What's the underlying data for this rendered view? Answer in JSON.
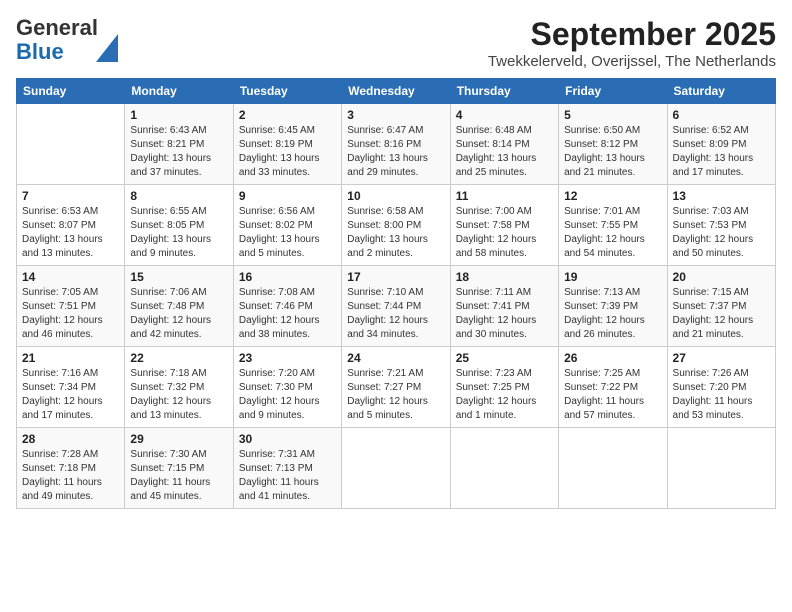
{
  "header": {
    "logo_line1": "General",
    "logo_line2": "Blue",
    "title": "September 2025",
    "subtitle": "Twekkelerveld, Overijssel, The Netherlands"
  },
  "columns": [
    "Sunday",
    "Monday",
    "Tuesday",
    "Wednesday",
    "Thursday",
    "Friday",
    "Saturday"
  ],
  "weeks": [
    [
      {
        "day": "",
        "info": ""
      },
      {
        "day": "1",
        "info": "Sunrise: 6:43 AM\nSunset: 8:21 PM\nDaylight: 13 hours\nand 37 minutes."
      },
      {
        "day": "2",
        "info": "Sunrise: 6:45 AM\nSunset: 8:19 PM\nDaylight: 13 hours\nand 33 minutes."
      },
      {
        "day": "3",
        "info": "Sunrise: 6:47 AM\nSunset: 8:16 PM\nDaylight: 13 hours\nand 29 minutes."
      },
      {
        "day": "4",
        "info": "Sunrise: 6:48 AM\nSunset: 8:14 PM\nDaylight: 13 hours\nand 25 minutes."
      },
      {
        "day": "5",
        "info": "Sunrise: 6:50 AM\nSunset: 8:12 PM\nDaylight: 13 hours\nand 21 minutes."
      },
      {
        "day": "6",
        "info": "Sunrise: 6:52 AM\nSunset: 8:09 PM\nDaylight: 13 hours\nand 17 minutes."
      }
    ],
    [
      {
        "day": "7",
        "info": "Sunrise: 6:53 AM\nSunset: 8:07 PM\nDaylight: 13 hours\nand 13 minutes."
      },
      {
        "day": "8",
        "info": "Sunrise: 6:55 AM\nSunset: 8:05 PM\nDaylight: 13 hours\nand 9 minutes."
      },
      {
        "day": "9",
        "info": "Sunrise: 6:56 AM\nSunset: 8:02 PM\nDaylight: 13 hours\nand 5 minutes."
      },
      {
        "day": "10",
        "info": "Sunrise: 6:58 AM\nSunset: 8:00 PM\nDaylight: 13 hours\nand 2 minutes."
      },
      {
        "day": "11",
        "info": "Sunrise: 7:00 AM\nSunset: 7:58 PM\nDaylight: 12 hours\nand 58 minutes."
      },
      {
        "day": "12",
        "info": "Sunrise: 7:01 AM\nSunset: 7:55 PM\nDaylight: 12 hours\nand 54 minutes."
      },
      {
        "day": "13",
        "info": "Sunrise: 7:03 AM\nSunset: 7:53 PM\nDaylight: 12 hours\nand 50 minutes."
      }
    ],
    [
      {
        "day": "14",
        "info": "Sunrise: 7:05 AM\nSunset: 7:51 PM\nDaylight: 12 hours\nand 46 minutes."
      },
      {
        "day": "15",
        "info": "Sunrise: 7:06 AM\nSunset: 7:48 PM\nDaylight: 12 hours\nand 42 minutes."
      },
      {
        "day": "16",
        "info": "Sunrise: 7:08 AM\nSunset: 7:46 PM\nDaylight: 12 hours\nand 38 minutes."
      },
      {
        "day": "17",
        "info": "Sunrise: 7:10 AM\nSunset: 7:44 PM\nDaylight: 12 hours\nand 34 minutes."
      },
      {
        "day": "18",
        "info": "Sunrise: 7:11 AM\nSunset: 7:41 PM\nDaylight: 12 hours\nand 30 minutes."
      },
      {
        "day": "19",
        "info": "Sunrise: 7:13 AM\nSunset: 7:39 PM\nDaylight: 12 hours\nand 26 minutes."
      },
      {
        "day": "20",
        "info": "Sunrise: 7:15 AM\nSunset: 7:37 PM\nDaylight: 12 hours\nand 21 minutes."
      }
    ],
    [
      {
        "day": "21",
        "info": "Sunrise: 7:16 AM\nSunset: 7:34 PM\nDaylight: 12 hours\nand 17 minutes."
      },
      {
        "day": "22",
        "info": "Sunrise: 7:18 AM\nSunset: 7:32 PM\nDaylight: 12 hours\nand 13 minutes."
      },
      {
        "day": "23",
        "info": "Sunrise: 7:20 AM\nSunset: 7:30 PM\nDaylight: 12 hours\nand 9 minutes."
      },
      {
        "day": "24",
        "info": "Sunrise: 7:21 AM\nSunset: 7:27 PM\nDaylight: 12 hours\nand 5 minutes."
      },
      {
        "day": "25",
        "info": "Sunrise: 7:23 AM\nSunset: 7:25 PM\nDaylight: 12 hours\nand 1 minute."
      },
      {
        "day": "26",
        "info": "Sunrise: 7:25 AM\nSunset: 7:22 PM\nDaylight: 11 hours\nand 57 minutes."
      },
      {
        "day": "27",
        "info": "Sunrise: 7:26 AM\nSunset: 7:20 PM\nDaylight: 11 hours\nand 53 minutes."
      }
    ],
    [
      {
        "day": "28",
        "info": "Sunrise: 7:28 AM\nSunset: 7:18 PM\nDaylight: 11 hours\nand 49 minutes."
      },
      {
        "day": "29",
        "info": "Sunrise: 7:30 AM\nSunset: 7:15 PM\nDaylight: 11 hours\nand 45 minutes."
      },
      {
        "day": "30",
        "info": "Sunrise: 7:31 AM\nSunset: 7:13 PM\nDaylight: 11 hours\nand 41 minutes."
      },
      {
        "day": "",
        "info": ""
      },
      {
        "day": "",
        "info": ""
      },
      {
        "day": "",
        "info": ""
      },
      {
        "day": "",
        "info": ""
      }
    ]
  ]
}
